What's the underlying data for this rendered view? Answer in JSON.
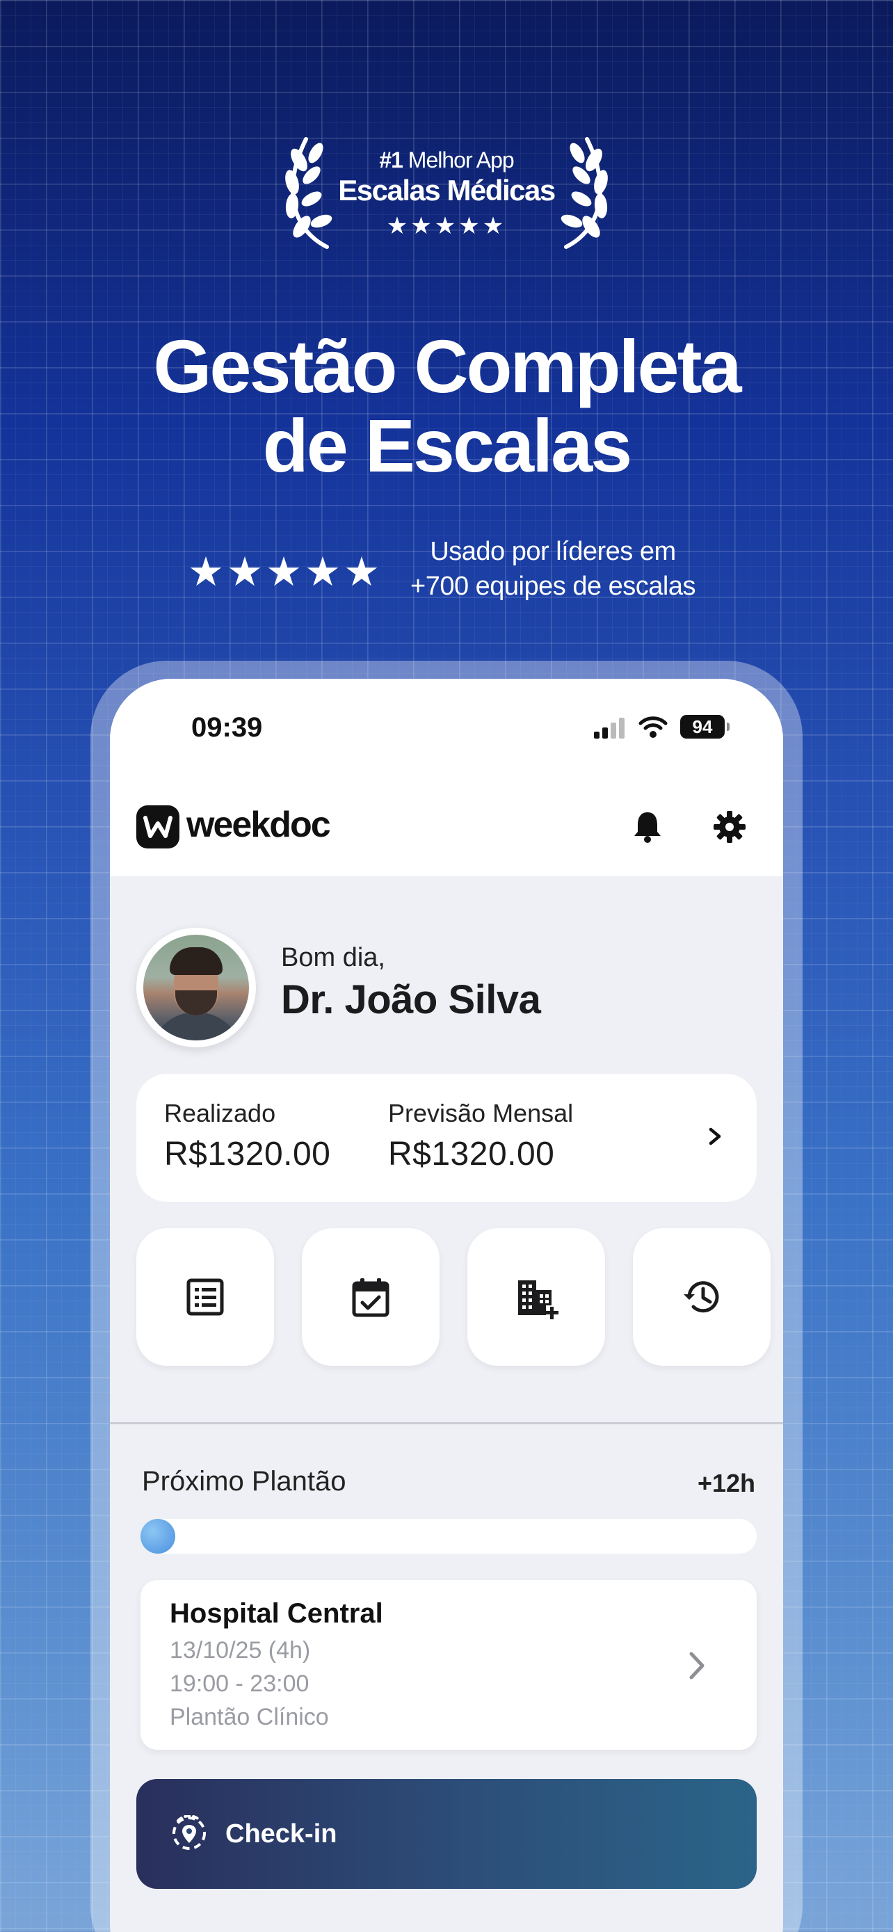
{
  "award": {
    "rank": "#1",
    "rank_rest": "Melhor App",
    "title": "Escalas Médicas",
    "stars": "★★★★★"
  },
  "headline": {
    "line1": "Gestão Completa",
    "line2": "de Escalas"
  },
  "rating": {
    "stars": "★★★★★",
    "line1": "Usado por líderes em",
    "line2": "+700 equipes de escalas"
  },
  "status_bar": {
    "time": "09:39",
    "battery": "94"
  },
  "app": {
    "logo_text": "weekdoc",
    "header_icons": [
      "bell-icon",
      "gear-icon"
    ]
  },
  "greeting": {
    "hello": "Bom dia,",
    "name": "Dr. João Silva"
  },
  "finance": {
    "realized_label": "Realizado",
    "realized_value": "R$1320.00",
    "forecast_label": "Previsão Mensal",
    "forecast_value": "R$1320.00"
  },
  "quick_actions": [
    {
      "icon": "list-icon"
    },
    {
      "icon": "calendar-check-icon"
    },
    {
      "icon": "building-add-icon"
    },
    {
      "icon": "history-icon"
    }
  ],
  "next_shift": {
    "label": "Próximo Plantão",
    "hours": "+12h",
    "hospital": "Hospital Central",
    "date": "13/10/25 (4h)",
    "time": "19:00 - 23:00",
    "type": "Plantão Clínico"
  },
  "checkin": {
    "label": "Check-in"
  },
  "colors": {
    "background_top": "#0b1a5c",
    "background_bottom": "#7aa5d9",
    "checkin_start": "#2a2f5c",
    "checkin_end": "#2b6488",
    "progress": "#4a8fe0"
  }
}
